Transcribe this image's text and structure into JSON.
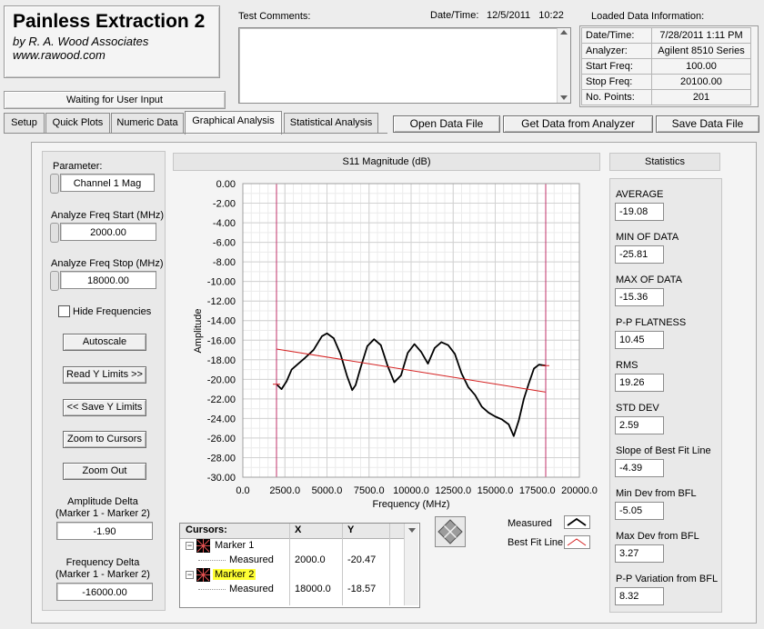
{
  "app": {
    "title": "Painless Extraction 2",
    "subtitle": "by R. A. Wood Associates",
    "url": "www.rawood.com",
    "status": "Waiting for User Input"
  },
  "header": {
    "test_comments_label": "Test Comments:",
    "datetime_label": "Date/Time:",
    "datetime_value": "12/5/2011   10:22",
    "loaded_label": "Loaded Data Information:",
    "loaded_rows": [
      {
        "label": "Date/Time:",
        "value": "7/28/2011 1:11 PM"
      },
      {
        "label": "Analyzer:",
        "value": "Agilent 8510 Series"
      },
      {
        "label": "Start Freq:",
        "value": "100.00"
      },
      {
        "label": "Stop Freq:",
        "value": "20100.00"
      },
      {
        "label": "No. Points:",
        "value": "201"
      }
    ]
  },
  "tabs": [
    "Setup",
    "Quick Plots",
    "Numeric Data",
    "Graphical Analysis",
    "Statistical Analysis"
  ],
  "toolbar": {
    "open": "Open Data File",
    "get": "Get Data from Analyzer",
    "save": "Save Data File"
  },
  "left": {
    "parameter_label": "Parameter:",
    "parameter_value": "Channel 1 Mag",
    "start_label": "Analyze Freq Start (MHz)",
    "start_value": "2000.00",
    "stop_label": "Analyze Freq Stop (MHz)",
    "stop_value": "18000.00",
    "hide_freq": "Hide Frequencies",
    "autoscale": "Autoscale",
    "read_y": "Read Y Limits >>",
    "save_y": "<< Save Y Limits",
    "zoom_cursors": "Zoom to Cursors",
    "zoom_out": "Zoom Out",
    "amp_delta_label_1": "Amplitude Delta",
    "amp_delta_label_2": "(Marker 1 - Marker 2)",
    "amp_delta_value": "-1.90",
    "freq_delta_label_1": "Frequency Delta",
    "freq_delta_label_2": "(Marker 1 - Marker 2)",
    "freq_delta_value": "-16000.00"
  },
  "cursors": {
    "header": "Cursors:",
    "col_x": "X",
    "col_y": "Y",
    "rows": [
      {
        "name": "Marker 1",
        "sub": "Measured",
        "x": "2000.0",
        "y": "-20.47"
      },
      {
        "name": "Marker 2",
        "sub": "Measured",
        "x": "18000.0",
        "y": "-18.57"
      }
    ]
  },
  "legend": {
    "measured": "Measured",
    "bfl": "Best Fit Line"
  },
  "stats": {
    "title": "Statistics",
    "items": [
      {
        "label": "AVERAGE",
        "value": "-19.08"
      },
      {
        "label": "MIN OF DATA",
        "value": "-25.81"
      },
      {
        "label": "MAX OF DATA",
        "value": "-15.36"
      },
      {
        "label": "P-P FLATNESS",
        "value": "10.45"
      },
      {
        "label": "RMS",
        "value": "19.26"
      },
      {
        "label": "STD DEV",
        "value": "2.59"
      },
      {
        "label": "Slope of Best Fit Line",
        "value": "-4.39"
      },
      {
        "label": "Min Dev from BFL",
        "value": "-5.05"
      },
      {
        "label": "Max Dev from BFL",
        "value": "3.27"
      },
      {
        "label": "P-P Variation from BFL",
        "value": "8.32"
      }
    ]
  },
  "colors": {
    "measured": "#000000",
    "bfl": "#d42020",
    "cursor": "#c0306a",
    "marker_highlight": "#ffff33"
  },
  "chart_data": {
    "type": "line",
    "title": "S11 Magnitude (dB)",
    "xlabel": "Frequency (MHz)",
    "ylabel": "Amplitude",
    "xlim": [
      0,
      20000
    ],
    "ylim": [
      -30,
      0
    ],
    "x_ticks": [
      "0.0",
      "2500.0",
      "5000.0",
      "7500.0",
      "10000.0",
      "12500.0",
      "15000.0",
      "17500.0",
      "20000.0"
    ],
    "y_ticks": [
      "0.00",
      "-2.00",
      "-4.00",
      "-6.00",
      "-8.00",
      "-10.00",
      "-12.00",
      "-14.00",
      "-16.00",
      "-18.00",
      "-20.00",
      "-22.00",
      "-24.00",
      "-26.00",
      "-28.00",
      "-30.00"
    ],
    "grid": true,
    "cursors_x": [
      2000,
      18000
    ],
    "series": [
      {
        "name": "Measured",
        "x": [
          2000,
          2300,
          2600,
          2900,
          3300,
          3700,
          4200,
          4700,
          5000,
          5400,
          5800,
          6200,
          6500,
          6700,
          7000,
          7400,
          7800,
          8200,
          8600,
          9000,
          9400,
          9800,
          10200,
          10600,
          11000,
          11400,
          11800,
          12200,
          12600,
          13000,
          13400,
          13800,
          14200,
          14600,
          15000,
          15400,
          15800,
          16100,
          16400,
          16700,
          17000,
          17300,
          17600,
          18000
        ],
        "y": [
          -20.5,
          -21.0,
          -20.2,
          -19.0,
          -18.4,
          -17.8,
          -17.0,
          -15.6,
          -15.3,
          -15.8,
          -17.4,
          -19.7,
          -21.1,
          -20.6,
          -18.8,
          -16.6,
          -15.9,
          -16.5,
          -18.6,
          -20.3,
          -19.6,
          -17.3,
          -16.4,
          -17.2,
          -18.4,
          -16.8,
          -16.2,
          -16.5,
          -17.4,
          -19.4,
          -20.8,
          -21.6,
          -22.8,
          -23.4,
          -23.8,
          -24.1,
          -24.6,
          -25.8,
          -24.2,
          -22.0,
          -20.4,
          -18.9,
          -18.5,
          -18.6
        ]
      },
      {
        "name": "Best Fit Line",
        "x": [
          2000,
          18000
        ],
        "y": [
          -16.9,
          -21.3
        ]
      }
    ]
  }
}
